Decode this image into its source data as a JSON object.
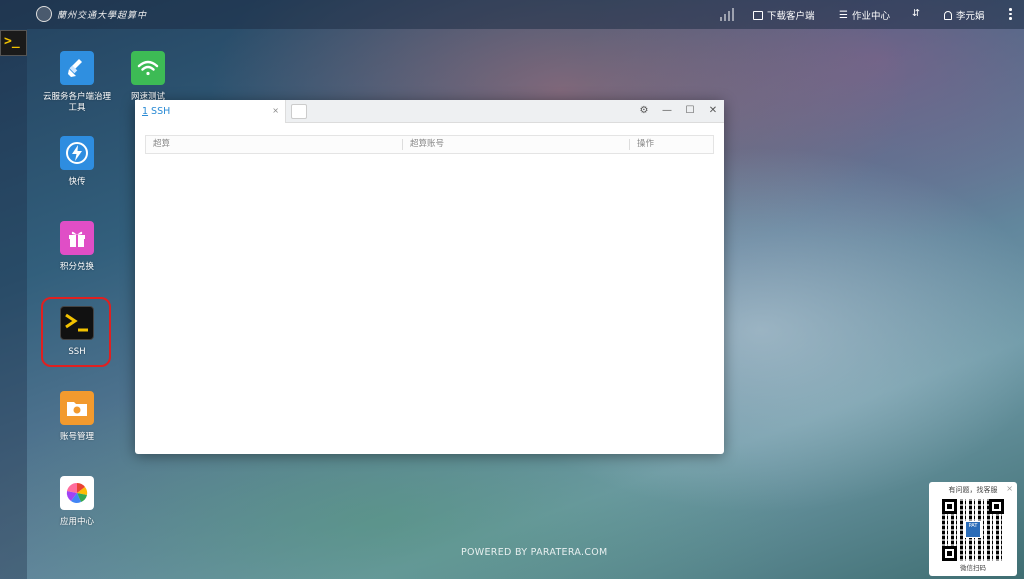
{
  "topbar": {
    "logo_text": "蘭州交通大學超算中",
    "download_label": "下载客户端",
    "jobs_label": "作业中心",
    "transfer_label": "⇵",
    "user_name": "李元娟"
  },
  "sidebar": {
    "terminal_glyph": ">_"
  },
  "desktop_apps": [
    {
      "label": "云服务各户端治理工具"
    },
    {
      "label": "网速测试"
    },
    {
      "label": "快传"
    },
    {
      "label": "积分兑换"
    },
    {
      "label": "SSH"
    },
    {
      "label": "账号管理"
    },
    {
      "label": "应用中心"
    }
  ],
  "window": {
    "tab_number": "1",
    "tab_title": "SSH",
    "tab_close": "×",
    "columns": [
      "超算",
      "超算账号",
      "操作"
    ]
  },
  "footer": {
    "powered": "POWERED BY PARATERA.COM"
  },
  "qr_card": {
    "title": "有问题，找客服",
    "badge": "PAT",
    "subtitle": "微信扫码",
    "close": "×"
  },
  "colors": {
    "tab_active": "#2a8ad4",
    "highlight": "#e02020"
  }
}
